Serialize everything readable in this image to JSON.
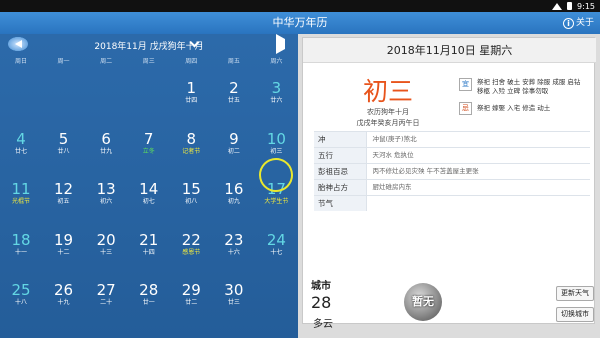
{
  "status": {
    "time": "9:15"
  },
  "app": {
    "title": "中华万年历",
    "about": "关于"
  },
  "nav": {
    "month_label": "2018年11月  戊戌狗年十月"
  },
  "weekdays": [
    "周日",
    "周一",
    "周二",
    "周三",
    "周四",
    "周五",
    "周六"
  ],
  "days": [
    {
      "n": "1",
      "sub": "廿四",
      "row": 0,
      "col": 4,
      "teal": false
    },
    {
      "n": "2",
      "sub": "廿五",
      "row": 0,
      "col": 5,
      "teal": false
    },
    {
      "n": "3",
      "sub": "廿六",
      "row": 0,
      "col": 6,
      "teal": true
    },
    {
      "n": "4",
      "sub": "廿七",
      "row": 1,
      "col": 0,
      "teal": true
    },
    {
      "n": "5",
      "sub": "廿八",
      "row": 1,
      "col": 1,
      "teal": false
    },
    {
      "n": "6",
      "sub": "廿九",
      "row": 1,
      "col": 2,
      "teal": false
    },
    {
      "n": "7",
      "sub": "立冬",
      "row": 1,
      "col": 3,
      "teal": false,
      "subc": "green"
    },
    {
      "n": "8",
      "sub": "记者节",
      "row": 1,
      "col": 4,
      "teal": false,
      "subc": "yellow"
    },
    {
      "n": "9",
      "sub": "初二",
      "row": 1,
      "col": 5,
      "teal": false
    },
    {
      "n": "10",
      "sub": "初三",
      "row": 1,
      "col": 6,
      "teal": true
    },
    {
      "n": "11",
      "sub": "光棍节",
      "row": 2,
      "col": 0,
      "teal": true,
      "subc": "yellow"
    },
    {
      "n": "12",
      "sub": "初五",
      "row": 2,
      "col": 1,
      "teal": false
    },
    {
      "n": "13",
      "sub": "初六",
      "row": 2,
      "col": 2,
      "teal": false
    },
    {
      "n": "14",
      "sub": "初七",
      "row": 2,
      "col": 3,
      "teal": false
    },
    {
      "n": "15",
      "sub": "初八",
      "row": 2,
      "col": 4,
      "teal": false
    },
    {
      "n": "16",
      "sub": "初九",
      "row": 2,
      "col": 5,
      "teal": false
    },
    {
      "n": "17",
      "sub": "大学生节",
      "row": 2,
      "col": 6,
      "teal": true,
      "subc": "yellow"
    },
    {
      "n": "18",
      "sub": "十一",
      "row": 3,
      "col": 0,
      "teal": true
    },
    {
      "n": "19",
      "sub": "十二",
      "row": 3,
      "col": 1,
      "teal": false
    },
    {
      "n": "20",
      "sub": "十三",
      "row": 3,
      "col": 2,
      "teal": false
    },
    {
      "n": "21",
      "sub": "十四",
      "row": 3,
      "col": 3,
      "teal": false
    },
    {
      "n": "22",
      "sub": "感恩节",
      "row": 3,
      "col": 4,
      "teal": false,
      "subc": "yellow"
    },
    {
      "n": "23",
      "sub": "十六",
      "row": 3,
      "col": 5,
      "teal": false
    },
    {
      "n": "24",
      "sub": "十七",
      "row": 3,
      "col": 6,
      "teal": true
    },
    {
      "n": "25",
      "sub": "十八",
      "row": 4,
      "col": 0,
      "teal": true
    },
    {
      "n": "26",
      "sub": "十九",
      "row": 4,
      "col": 1,
      "teal": false
    },
    {
      "n": "27",
      "sub": "二十",
      "row": 4,
      "col": 2,
      "teal": false
    },
    {
      "n": "28",
      "sub": "廿一",
      "row": 4,
      "col": 3,
      "teal": false
    },
    {
      "n": "29",
      "sub": "廿二",
      "row": 4,
      "col": 4,
      "teal": false
    },
    {
      "n": "30",
      "sub": "廿三",
      "row": 4,
      "col": 5,
      "teal": false
    }
  ],
  "detail": {
    "date": "2018年11月10日  星期六",
    "lunar_day": "初三",
    "lunar_month": "农历狗年十月",
    "ganzhi": "戊戌年癸亥月丙午日",
    "yi_label": "宜",
    "yi": "祭祀 扫舍 破土 安葬 除服 成服 启钻 移柩 入殓 立碑 馀事勿取",
    "ji_label": "忌",
    "ji": "祭祀 嫁娶 入宅 修造 动土",
    "rows": [
      {
        "k": "冲",
        "v": "冲鼠(庚子)煞北"
      },
      {
        "k": "五行",
        "v": "天河水 危执位"
      },
      {
        "k": "彭祖百忌",
        "v": "丙不修灶必见灾殃 午不苫盖屋主更张"
      },
      {
        "k": "胎神占方",
        "v": "厨灶碓房内东"
      },
      {
        "k": "节气",
        "v": ""
      }
    ]
  },
  "weather": {
    "city": "城市",
    "temp": "28",
    "condition": "多云",
    "moon_text": "暂无",
    "refresh": "更新天气",
    "switch_city": "切换城市"
  }
}
